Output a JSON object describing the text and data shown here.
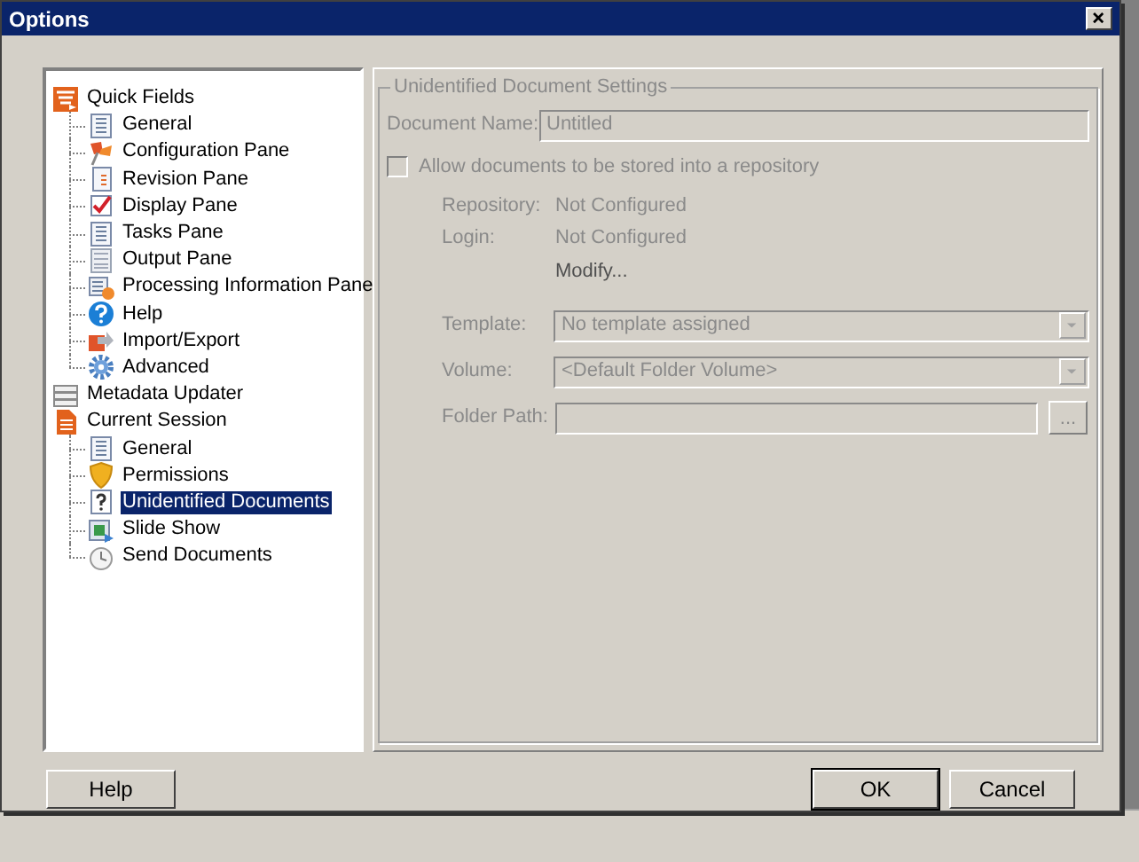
{
  "window": {
    "title": "Options"
  },
  "tree": [
    {
      "label": "Quick Fields",
      "selected": false,
      "children": [
        {
          "label": "General",
          "selected": false
        },
        {
          "label": "Configuration Pane",
          "selected": false
        },
        {
          "label": "Revision Pane",
          "selected": false
        },
        {
          "label": "Display Pane",
          "selected": false
        },
        {
          "label": "Tasks Pane",
          "selected": false
        },
        {
          "label": "Output Pane",
          "selected": false
        },
        {
          "label": "Processing Information Pane",
          "selected": false
        },
        {
          "label": "Help",
          "selected": false
        },
        {
          "label": "Import/Export",
          "selected": false
        },
        {
          "label": "Advanced",
          "selected": false
        }
      ]
    },
    {
      "label": "Metadata Updater",
      "selected": false
    },
    {
      "label": "Current Session",
      "selected": false,
      "children": [
        {
          "label": "General",
          "selected": false
        },
        {
          "label": "Permissions",
          "selected": false
        },
        {
          "label": "Unidentified Documents",
          "selected": true
        },
        {
          "label": "Slide Show",
          "selected": false
        },
        {
          "label": "Send Documents",
          "selected": false
        }
      ]
    }
  ],
  "settings": {
    "group_title": "Unidentified Document Settings",
    "disabled": true,
    "document_name": {
      "label": "Document Name:",
      "value": "Untitled"
    },
    "allow_repository": {
      "label": "Allow documents to be stored into a repository",
      "checked": false
    },
    "repository": {
      "label": "Repository:",
      "value": "Not Configured"
    },
    "login": {
      "label": "Login:",
      "value": "Not Configured"
    },
    "modify_link": "Modify...",
    "template": {
      "label": "Template:",
      "value": "No template assigned"
    },
    "volume": {
      "label": "Volume:",
      "value": "<Default Folder Volume>"
    },
    "folder_path": {
      "label": "Folder Path:",
      "browse": "..."
    }
  },
  "buttons": {
    "help": "Help",
    "ok": "OK",
    "cancel": "Cancel"
  }
}
